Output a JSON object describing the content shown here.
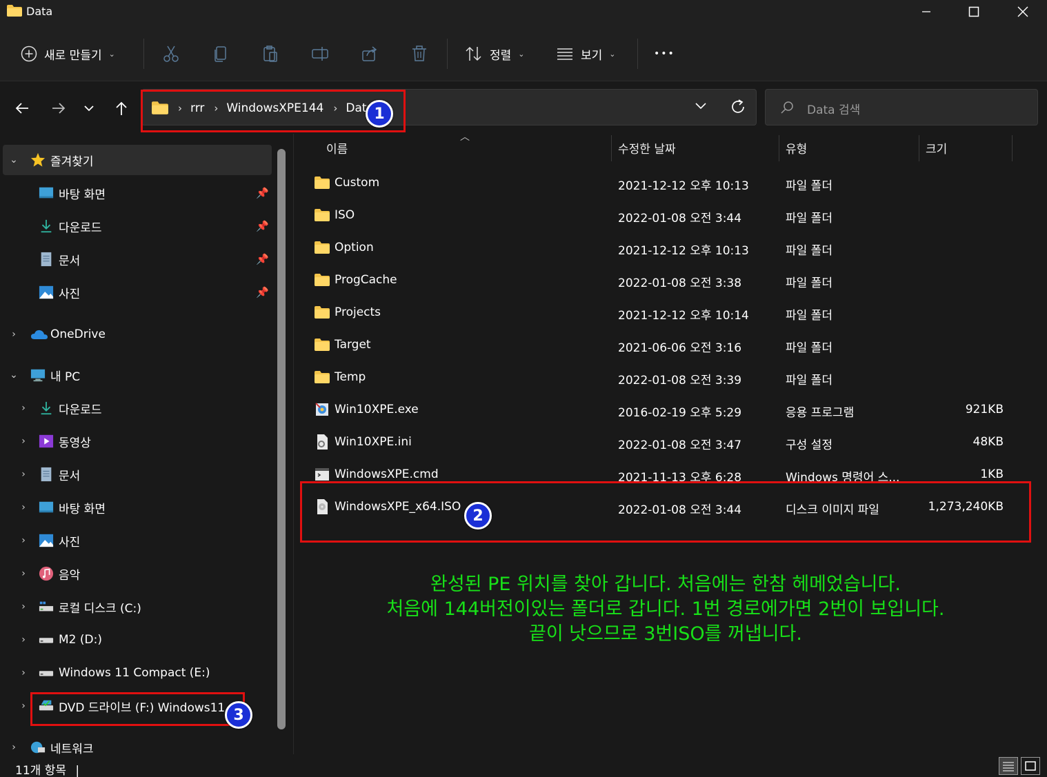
{
  "window": {
    "title": "Data",
    "controls": {
      "minimize": "─",
      "maximize": "☐",
      "close": "✕"
    }
  },
  "commandbar": {
    "new_label": "새로 만들기",
    "sort_label": "정렬",
    "view_label": "보기",
    "more_label": "•••",
    "icons": [
      "cut-icon",
      "copy-icon",
      "paste-icon",
      "rename-icon",
      "share-icon",
      "delete-icon"
    ]
  },
  "navigation": {
    "back": "←",
    "forward": "→",
    "recent": "⌄",
    "up": "↑"
  },
  "address": {
    "crumbs": [
      "rrr",
      "WindowsXPE144",
      "Data"
    ],
    "separator": "›"
  },
  "search": {
    "placeholder": "Data 검색"
  },
  "sidebar": {
    "favorites": {
      "label": "즐겨찾기",
      "items": [
        {
          "label": "바탕 화면",
          "icon": "desktop-icon",
          "pinned": true
        },
        {
          "label": "다운로드",
          "icon": "download-icon",
          "pinned": true
        },
        {
          "label": "문서",
          "icon": "document-icon",
          "pinned": true
        },
        {
          "label": "사진",
          "icon": "pictures-icon",
          "pinned": true
        }
      ]
    },
    "onedrive": {
      "label": "OneDrive"
    },
    "this_pc": {
      "label": "내 PC",
      "items": [
        {
          "label": "다운로드",
          "icon": "download-icon"
        },
        {
          "label": "동영상",
          "icon": "video-icon"
        },
        {
          "label": "문서",
          "icon": "document-icon"
        },
        {
          "label": "바탕 화면",
          "icon": "desktop-icon"
        },
        {
          "label": "사진",
          "icon": "pictures-icon"
        },
        {
          "label": "음악",
          "icon": "music-icon"
        },
        {
          "label": "로컬 디스크 (C:)",
          "icon": "system-drive-icon"
        },
        {
          "label": "M2 (D:)",
          "icon": "drive-icon"
        },
        {
          "label": "Windows 11 Compact (E:)",
          "icon": "drive-icon"
        },
        {
          "label": "DVD 드라이브 (F:) Windows11",
          "icon": "dvd-drive-icon"
        }
      ]
    },
    "network": {
      "label": "네트워크"
    }
  },
  "filelist": {
    "columns": {
      "name": "이름",
      "modified": "수정한 날짜",
      "type": "유형",
      "size": "크기"
    },
    "sort_indicator": "︿",
    "rows": [
      {
        "name": "Custom",
        "modified": "2021-12-12 오후 10:13",
        "type": "파일 폴더",
        "size": "",
        "icon": "folder-icon"
      },
      {
        "name": "ISO",
        "modified": "2022-01-08 오전 3:44",
        "type": "파일 폴더",
        "size": "",
        "icon": "folder-icon"
      },
      {
        "name": "Option",
        "modified": "2021-12-12 오후 10:13",
        "type": "파일 폴더",
        "size": "",
        "icon": "folder-icon"
      },
      {
        "name": "ProgCache",
        "modified": "2022-01-08 오전 3:38",
        "type": "파일 폴더",
        "size": "",
        "icon": "folder-icon"
      },
      {
        "name": "Projects",
        "modified": "2021-12-12 오후 10:14",
        "type": "파일 폴더",
        "size": "",
        "icon": "folder-icon"
      },
      {
        "name": "Target",
        "modified": "2021-06-06 오전 3:16",
        "type": "파일 폴더",
        "size": "",
        "icon": "folder-icon"
      },
      {
        "name": "Temp",
        "modified": "2022-01-08 오전 3:39",
        "type": "파일 폴더",
        "size": "",
        "icon": "folder-icon"
      },
      {
        "name": "Win10XPE.exe",
        "modified": "2016-02-19 오후 5:29",
        "type": "응용 프로그램",
        "size": "921KB",
        "icon": "exe-icon"
      },
      {
        "name": "Win10XPE.ini",
        "modified": "2022-01-08 오전 3:47",
        "type": "구성 설정",
        "size": "48KB",
        "icon": "ini-icon"
      },
      {
        "name": "WindowsXPE.cmd",
        "modified": "2021-11-13 오후 6:28",
        "type": "Windows 명령어 스...",
        "size": "1KB",
        "icon": "cmd-icon"
      },
      {
        "name": "WindowsXPE_x64.ISO",
        "modified": "2022-01-08 오전 3:44",
        "type": "디스크 이미지 파일",
        "size": "1,273,240KB",
        "icon": "disc-image-icon"
      }
    ]
  },
  "annotations": {
    "badges": [
      "1",
      "2",
      "3"
    ],
    "lines": [
      "완성된 PE 위치를 찾아 갑니다. 처음에는 한참 헤메었습니다.",
      "처음에 144버전이있는 폴더로 갑니다. 1번 경로에가면 2번이 보입니다.",
      "끝이 낫으므로 3번ISO를 꺼냅니다."
    ],
    "box_color": "#e01010",
    "text_color": "#18e018",
    "badge_color": "#1a2fd6"
  },
  "status": {
    "item_count": "11개 항목",
    "cursor": "|"
  },
  "colors": {
    "folder": "#f3c44a",
    "background": "#191919",
    "toolbar": "#202020"
  }
}
